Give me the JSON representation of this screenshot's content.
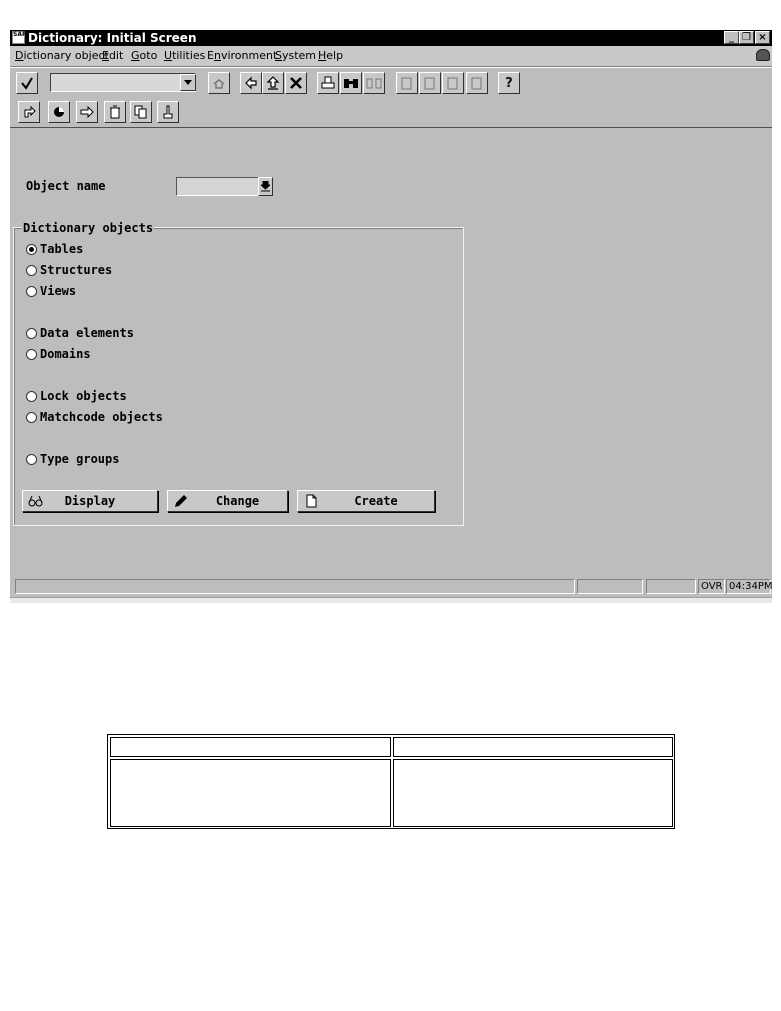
{
  "window": {
    "title": "Dictionary: Initial Screen",
    "app_icon_text": "SAP",
    "controls": {
      "minimize": "_",
      "restore": "❐",
      "close": "×"
    }
  },
  "menubar": {
    "items": [
      {
        "label": "Dictionary object",
        "mnemonic": "D"
      },
      {
        "label": "Edit",
        "mnemonic": "E"
      },
      {
        "label": "Goto",
        "mnemonic": "G"
      },
      {
        "label": "Utilities",
        "mnemonic": "U"
      },
      {
        "label": "Environment",
        "mnemonic": "n"
      },
      {
        "label": "System",
        "mnemonic": "S"
      },
      {
        "label": "Help",
        "mnemonic": "H"
      }
    ]
  },
  "toolbar": {
    "command_field_value": "",
    "icons": [
      "enter-check-icon",
      "save-icon",
      "back-icon",
      "exit-icon",
      "cancel-icon",
      "print-icon",
      "find-icon",
      "find-next-icon",
      "first-page-icon",
      "previous-page-icon",
      "next-page-icon",
      "last-page-icon",
      "help-icon"
    ]
  },
  "app_toolbar": {
    "icons": [
      "other-object-icon",
      "check-icon",
      "activate-icon",
      "delete-icon",
      "copy-icon",
      "where-used-icon"
    ]
  },
  "form": {
    "object_name_label": "Object name",
    "object_name_value": ""
  },
  "dictionary_objects": {
    "title": "Dictionary objects",
    "selected": "Tables",
    "options": [
      "Tables",
      "Structures",
      "Views",
      "Data elements",
      "Domains",
      "Lock objects",
      "Matchcode objects",
      "Type groups"
    ]
  },
  "buttons": {
    "display": "Display",
    "change": "Change",
    "create": "Create"
  },
  "statusbar": {
    "mode": "OVR",
    "time": "04:34PM"
  },
  "empty_table": {
    "headers": [
      "",
      ""
    ],
    "rows": [
      [
        "",
        ""
      ]
    ]
  }
}
